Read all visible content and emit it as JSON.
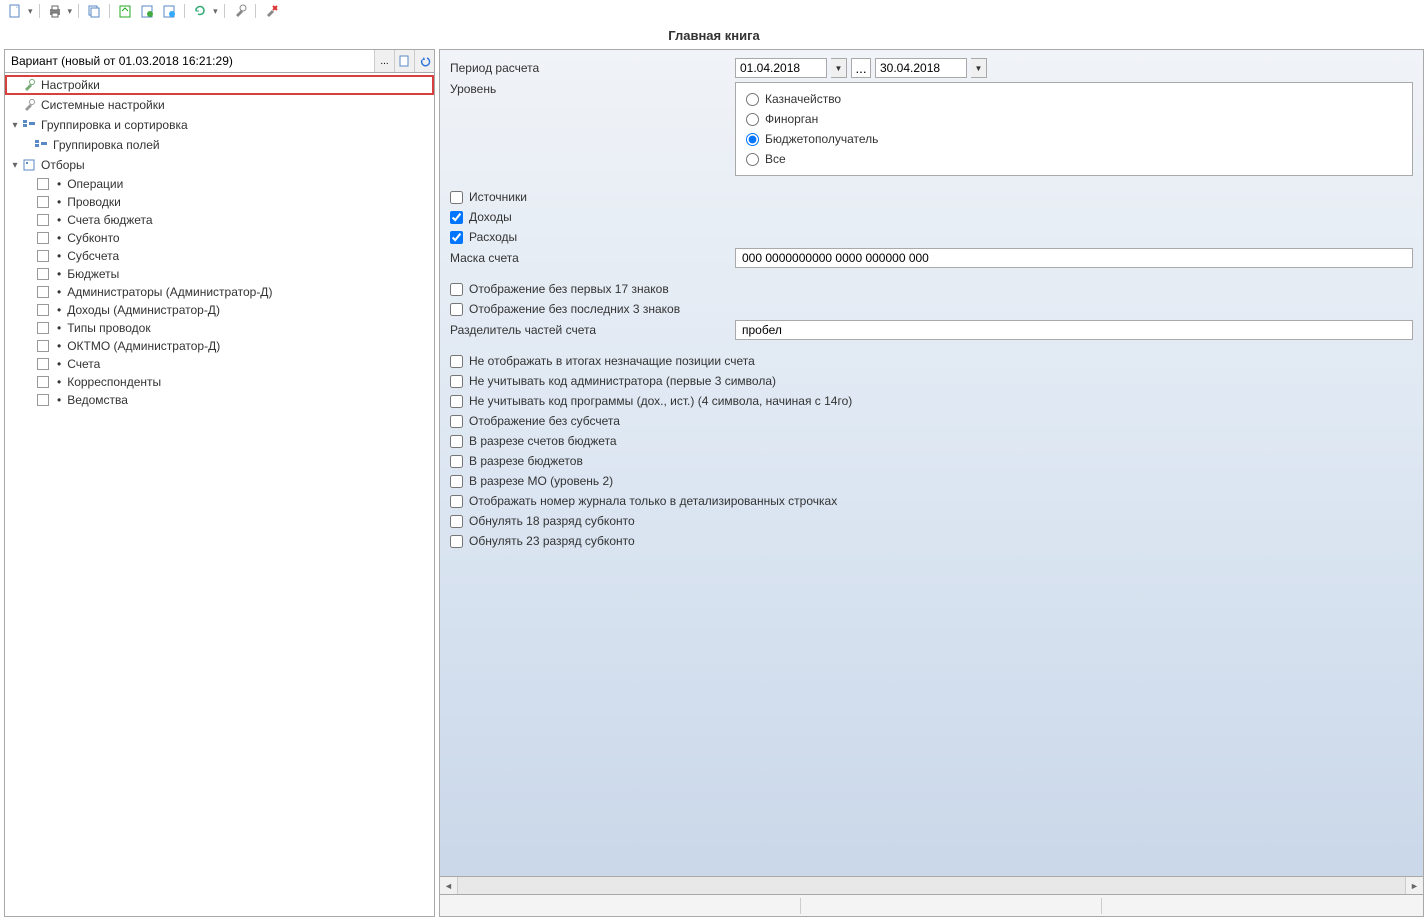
{
  "title": "Главная книга",
  "toolbar_icons": [
    "doc",
    "print",
    "copy",
    "sheet",
    "export1",
    "export2",
    "refresh",
    "tools",
    "tools-del"
  ],
  "variant": {
    "value": "Вариант (новый от 01.03.2018 16:21:29)",
    "ellipsis": "...",
    "new_icon": "new",
    "undo_icon": "undo"
  },
  "tree": {
    "settings": "Настройки",
    "sys_settings": "Системные настройки",
    "grouping": "Группировка и сортировка",
    "field_grouping": "Группировка полей",
    "filters": "Отборы",
    "filter_items": [
      "Операции",
      "Проводки",
      "Счета бюджета",
      "Субконто",
      "Субсчета",
      "Бюджеты",
      "Администраторы (Администратор-Д)",
      "Доходы (Администратор-Д)",
      "Типы проводок",
      "ОКТМО (Администратор-Д)",
      "Счета",
      "Корреспонденты",
      "Ведомства"
    ]
  },
  "form": {
    "period_label": "Период расчета",
    "date_from": "01.04.2018",
    "date_to": "30.04.2018",
    "level_label": "Уровень",
    "level_opts": {
      "treasury": "Казначейство",
      "finorgan": "Финорган",
      "budget_recipient": "Бюджетополучатель",
      "all": "Все"
    },
    "sources": "Источники",
    "income": "Доходы",
    "expenses": "Расходы",
    "mask_label": "Маска счета",
    "mask_value": "000 0000000000 0000 000000 000",
    "hide_first17": "Отображение без первых 17 знаков",
    "hide_last3": "Отображение без последних 3 знаков",
    "separator_label": "Разделитель частей счета",
    "separator_value": "пробел",
    "no_leading_totals": "Не отображать в итогах незначащие позиции счета",
    "no_admin_code": "Не учитывать код администратора (первые 3 символа)",
    "no_program_code": "Не учитывать код программы (дох., ист.) (4 символа, начиная с 14го)",
    "no_subacct": "Отображение без субсчета",
    "by_budget_accounts": "В разрезе счетов бюджета",
    "by_budgets": "В разрезе бюджетов",
    "by_mo": "В разрезе МО (уровень 2)",
    "journal_detail": "Отображать номер журнала только в детализированных строчках",
    "zero_18": "Обнулять 18 разряд субконто",
    "zero_23": "Обнулять 23 разряд субконто"
  }
}
